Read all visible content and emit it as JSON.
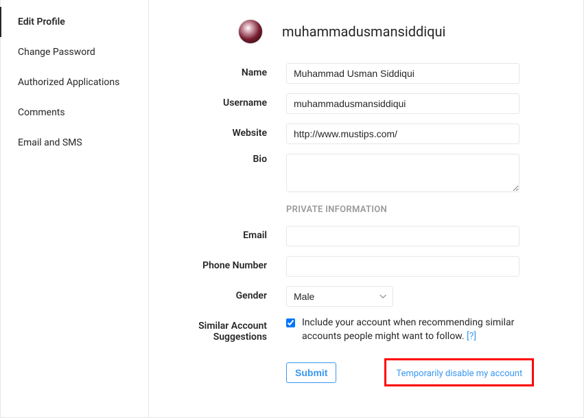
{
  "sidebar": {
    "items": [
      {
        "label": "Edit Profile"
      },
      {
        "label": "Change Password"
      },
      {
        "label": "Authorized Applications"
      },
      {
        "label": "Comments"
      },
      {
        "label": "Email and SMS"
      }
    ]
  },
  "profile": {
    "display_username": "muhammadusmansiddiqui"
  },
  "form": {
    "name_label": "Name",
    "name_value": "Muhammad Usman Siddiqui",
    "username_label": "Username",
    "username_value": "muhammadusmansiddiqui",
    "website_label": "Website",
    "website_value": "http://www.mustips.com/",
    "bio_label": "Bio",
    "bio_value": "",
    "private_header": "PRIVATE INFORMATION",
    "email_label": "Email",
    "email_value": "",
    "phone_label": "Phone Number",
    "phone_value": "",
    "gender_label": "Gender",
    "gender_value": "Male",
    "similar_label_1": "Similar Account",
    "similar_label_2": "Suggestions",
    "similar_text": "Include your account when recommending similar accounts people might want to follow. ",
    "similar_help": "[?]",
    "submit_label": "Submit",
    "disable_label": "Temporarily disable my account"
  }
}
